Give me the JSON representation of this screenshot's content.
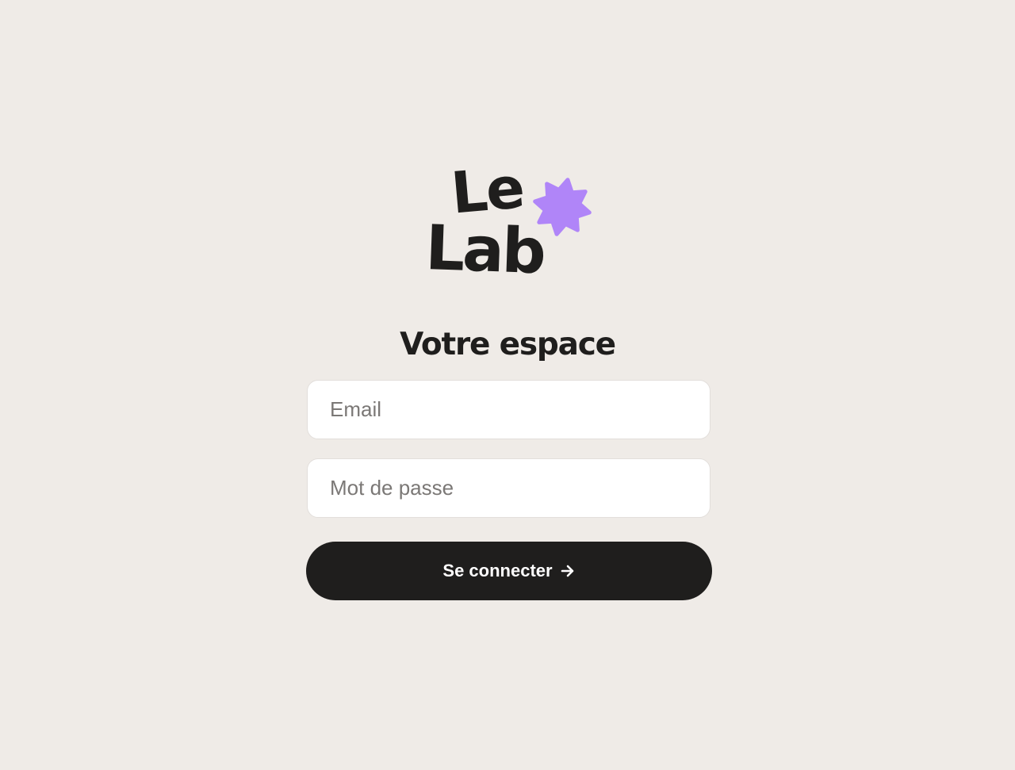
{
  "brand": {
    "line1": "Le",
    "line2": "Lab",
    "accent_color": "#b085f8",
    "ink_color": "#1f1e1d"
  },
  "page": {
    "title": "Votre espace",
    "background_color": "#efebe7"
  },
  "form": {
    "email": {
      "placeholder": "Email",
      "value": ""
    },
    "password": {
      "placeholder": "Mot de passe",
      "value": ""
    },
    "submit": {
      "label": "Se connecter",
      "icon": "arrow-right-icon"
    }
  }
}
